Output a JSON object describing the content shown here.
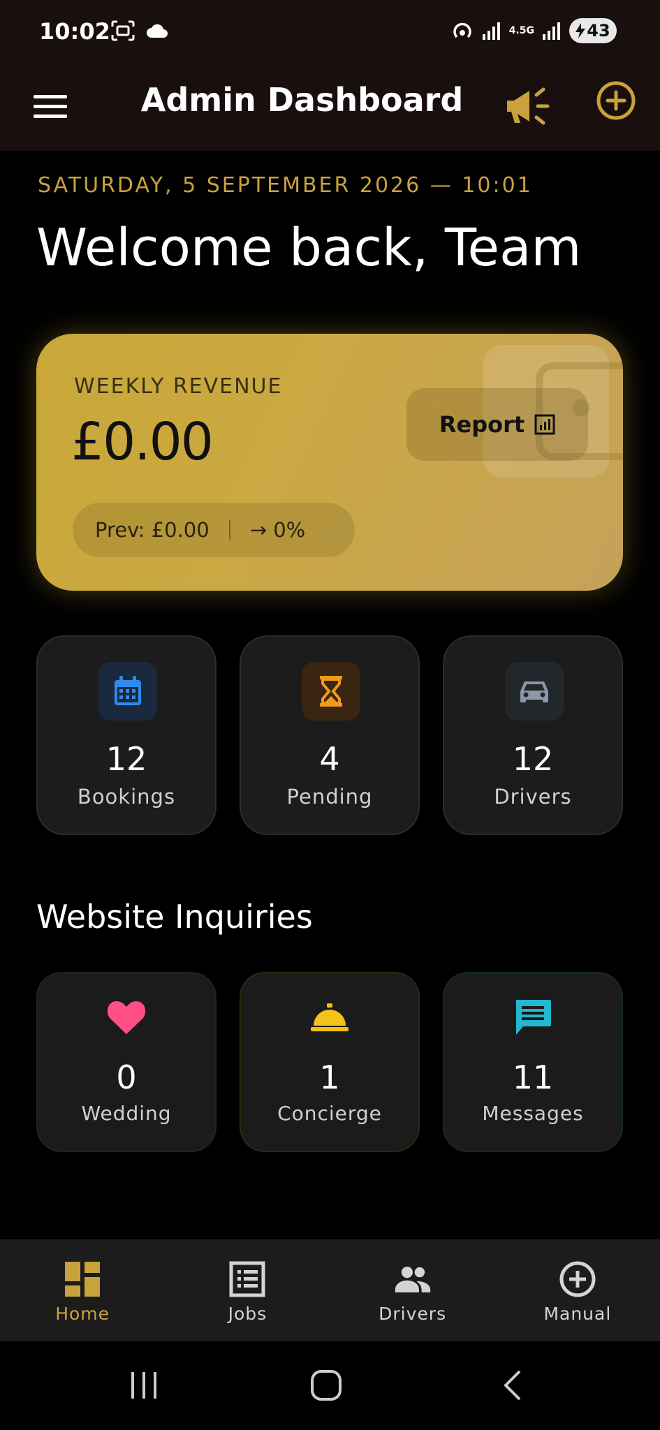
{
  "status_bar": {
    "time": "10:02",
    "network": "4.5G",
    "battery": "43"
  },
  "app_bar": {
    "title": "Admin Dashboard"
  },
  "header": {
    "date": "SATURDAY, 5 SEPTEMBER 2026 — 10:01",
    "welcome": "Welcome back, Team"
  },
  "revenue": {
    "label": "WEEKLY REVENUE",
    "amount": "£0.00",
    "report_label": "Report",
    "prev": "Prev: £0.00",
    "change": "→ 0%"
  },
  "stats": [
    {
      "value": "12",
      "label": "Bookings",
      "icon": "calendar-icon",
      "color": "#2f8ae8"
    },
    {
      "value": "4",
      "label": "Pending",
      "icon": "hourglass-icon",
      "color": "#f09a1a"
    },
    {
      "value": "12",
      "label": "Drivers",
      "icon": "car-icon",
      "color": "#8a98a8"
    }
  ],
  "inquiries": {
    "title": "Website Inquiries",
    "items": [
      {
        "value": "0",
        "label": "Wedding",
        "icon": "heart-icon",
        "color": "#ff4f86"
      },
      {
        "value": "1",
        "label": "Concierge",
        "icon": "service-bell-icon",
        "color": "#f5c21b"
      },
      {
        "value": "11",
        "label": "Messages",
        "icon": "message-icon",
        "color": "#22b8d0"
      }
    ]
  },
  "bottom_nav": [
    {
      "label": "Home",
      "icon": "dashboard-icon",
      "active": true
    },
    {
      "label": "Jobs",
      "icon": "list-icon",
      "active": false
    },
    {
      "label": "Drivers",
      "icon": "people-icon",
      "active": false
    },
    {
      "label": "Manual",
      "icon": "add-circle-icon",
      "active": false
    }
  ],
  "colors": {
    "accent": "#c9a23c",
    "background": "#000000",
    "card": "#1c1c1c",
    "appbar": "#1a0f0f"
  }
}
